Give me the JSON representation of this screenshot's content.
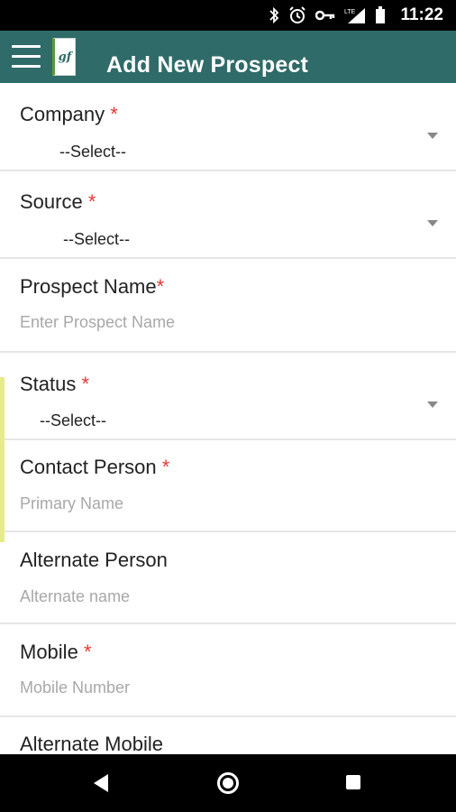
{
  "status_bar": {
    "time": "11:22",
    "icons": [
      "bluetooth-icon",
      "alarm-icon",
      "key-icon",
      "lte-signal-icon",
      "battery-icon"
    ],
    "network_label": "LTE"
  },
  "app_bar": {
    "title": "Add New Prospect",
    "logo_text": "gf",
    "colors": {
      "background": "#2f6b69",
      "title": "#ffffff"
    }
  },
  "form": {
    "required_marker": "*",
    "required_color": "#e53935",
    "fields": [
      {
        "label": "Company",
        "type": "select",
        "value": "--Select--",
        "required": true
      },
      {
        "label": "Source",
        "type": "select",
        "value": "--Select--",
        "required": true
      },
      {
        "label": "Prospect Name",
        "type": "text",
        "placeholder": "Enter Prospect Name",
        "required": true
      },
      {
        "label": "Status",
        "type": "select",
        "value": "--Select--",
        "required": true
      },
      {
        "label": "Contact Person",
        "type": "text",
        "placeholder": "Primary Name",
        "required": true
      },
      {
        "label": "Alternate Person",
        "type": "text",
        "placeholder": "Alternate name",
        "required": false
      },
      {
        "label": "Mobile",
        "type": "text",
        "placeholder": "Mobile Number",
        "required": true
      },
      {
        "label": "Alternate Mobile",
        "type": "text",
        "placeholder": "",
        "required": false
      }
    ]
  },
  "nav_bar": {
    "buttons": [
      "back-icon",
      "home-icon",
      "recents-icon"
    ]
  }
}
